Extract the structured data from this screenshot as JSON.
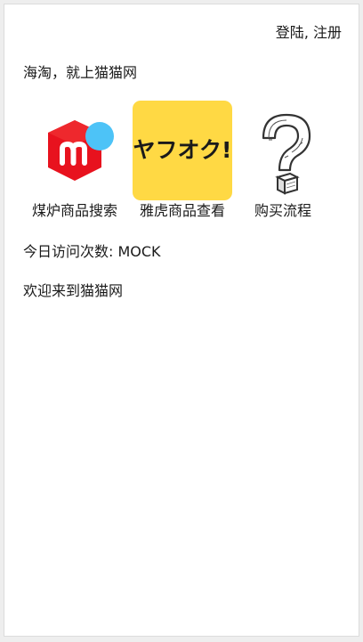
{
  "header": {
    "login_label": "登陆",
    "separator": ", ",
    "register_label": "注册"
  },
  "tagline": "海淘，就上猫猫网",
  "tiles": [
    {
      "label": "煤炉商品搜索",
      "icon": "mercari-logo-icon"
    },
    {
      "label": "雅虎商品查看",
      "icon": "yahoo-auction-logo-icon",
      "logo_text": "ヤフオク!"
    },
    {
      "label": "购买流程",
      "icon": "question-mark-icon"
    }
  ],
  "visits": {
    "label": "今日访问次数: ",
    "value": "MOCK"
  },
  "welcome": "欢迎来到猫猫网",
  "colors": {
    "mercari_red": "#e8121e",
    "mercari_blue": "#4dc3f7",
    "yahoo_yellow": "#ffd944"
  }
}
